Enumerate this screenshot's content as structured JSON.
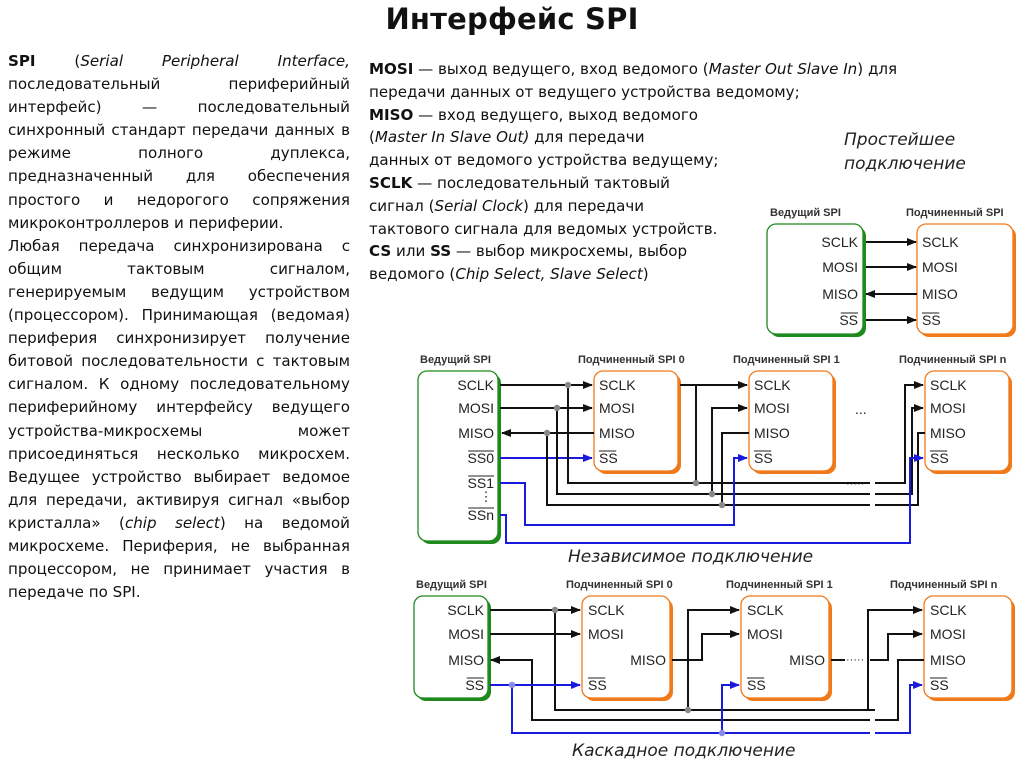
{
  "title": "Интерфейс SPI",
  "left_text": {
    "p1_bold": "SPI",
    "p1_open": " (",
    "p1_italic": "Serial Peripheral Interface,",
    "p1_rest": " последовательный периферийный интерфейс) — последовательный синхронный стандарт передачи данных в режиме полного дуплекса, предназначенный для обеспечения простого и недорогого сопряжения микроконтроллеров и периферии.",
    "p2": "Любая передача синхронизирована с общим тактовым сигналом, генерируемым ведущим устройством (процессором). Принимающая (ведомая) периферия синхронизирует получение битовой последовательности с тактовым сигналом. К одному последовательному периферийному интерфейсу ведущего устройства-микросхемы может присоединяться несколько микросхем. Ведущее устройство выбирает ведомое для передачи, активируя сигнал «выбор кристалла» (",
    "p2_italic": "chip select",
    "p2_rest": ") на ведомой микросхеме. Периферия, не выбранная процессором, не принимает участия в передаче по SPI."
  },
  "signals": {
    "mosi": {
      "name": "MOSI",
      "l1": " — выход ведущего, вход ведомого (",
      "l1_it": "Master Out Slave In",
      "l1_end": ") для",
      "l2": "передачи данных от ведущего устройства ведомому;"
    },
    "miso": {
      "name": "MISO",
      "l1": " — вход ведущего, выход ведомого",
      "l2_open": " (",
      "l2_it": "Master In Slave Out)",
      "l2_end": " для передачи",
      "l3": "данных от ведомого устройства ведущему;"
    },
    "sclk": {
      "name": "SCLK",
      "l1": " — последовательный тактовый",
      "l2_a": "сигнал (",
      "l2_it": "Serial Clock",
      "l2_end": ") для передачи",
      "l3": "тактового сигнала для ведомых устройств."
    },
    "cs": {
      "name1": "CS",
      "or": " или ",
      "name2": "SS",
      "l1": " — выбор микросхемы, выбор",
      "l2_a": "ведомого (",
      "l2_it": "Chip Select, Slave Select",
      "l2_end": ")"
    }
  },
  "diagrams": {
    "simple": {
      "caption_l1": "Простейшее",
      "caption_l2": "подключение",
      "master_label": "Ведущий SPI",
      "slave_label": "Подчиненный SPI",
      "pins": [
        "SCLK",
        "MOSI",
        "MISO",
        "SS"
      ]
    },
    "independent": {
      "caption": "Независимое подключение",
      "master_label": "Ведущий SPI",
      "slave_labels": [
        "Подчиненный SPI 0",
        "Подчиненный SPI 1",
        "Подчиненный SPI n"
      ],
      "master_pins": [
        "SCLK",
        "MOSI",
        "MISO",
        "SS0",
        "SS1",
        "⋮",
        "SSn"
      ],
      "slave_pins": [
        "SCLK",
        "MOSI",
        "MISO",
        "SS"
      ],
      "ellipsis": "..."
    },
    "cascade": {
      "caption": "Каскадное подключение",
      "master_label": "Ведущий SPI",
      "slave_labels": [
        "Подчиненный SPI 0",
        "Подчиненный SPI 1",
        "Подчиненный SPI n"
      ],
      "master_pins": [
        "SCLK",
        "MOSI",
        "MISO",
        "SS"
      ],
      "slave_pins": [
        "SCLK",
        "MOSI",
        "MISO",
        "SS"
      ]
    }
  },
  "colors": {
    "master": "#1e8a1e",
    "slave": "#f07a1a",
    "wire": "#111111",
    "select_wire": "#1a1adc",
    "junction": "#888888"
  }
}
